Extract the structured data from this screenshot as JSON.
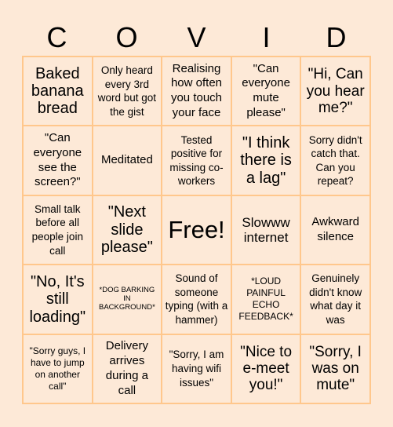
{
  "title_letters": [
    "C",
    "O",
    "V",
    "I",
    "D"
  ],
  "colors": {
    "background": "#fde9d7",
    "grid_border": "#ffc78c",
    "text": "#000000"
  },
  "cells": [
    [
      "Baked banana bread",
      "Only heard every 3rd word but got the gist",
      "Realising how often you touch your face",
      "\"Can everyone mute please\"",
      "\"Hi, Can you hear me?\""
    ],
    [
      "\"Can everyone see the screen?\"",
      "Meditated",
      "Tested positive for missing co-workers",
      "\"I think there is a lag\"",
      "Sorry didn't catch that. Can you repeat?"
    ],
    [
      "Small talk before all people join call",
      "\"Next slide please\"",
      "Free!",
      "Slowww internet",
      "Awkward silence"
    ],
    [
      "\"No, It's still loading\"",
      "*DOG BARKING IN BACKGROUND*",
      "Sound of someone typing (with a hammer)",
      "*LOUD PAINFUL ECHO FEEDBACK*",
      "Genuinely didn't know what day it was"
    ],
    [
      "\"Sorry guys, I have to jump on another call\"",
      "Delivery arrives during a call",
      "\"Sorry, I am having wifi issues\"",
      "\"Nice to e-meet you!\"",
      "\"Sorry, I was on mute\""
    ]
  ]
}
